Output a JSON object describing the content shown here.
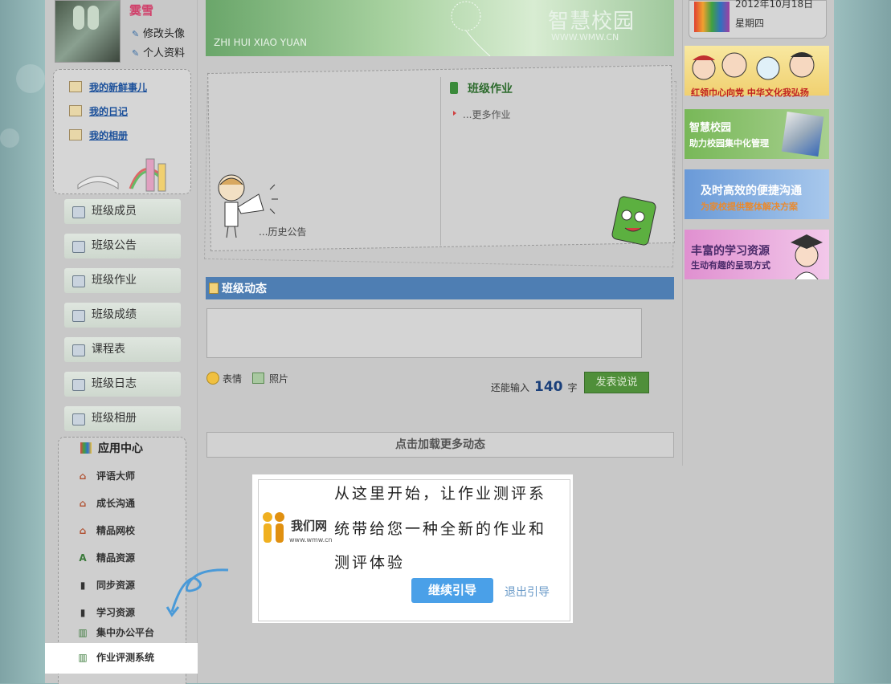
{
  "profile": {
    "name": "霙雪",
    "links": [
      {
        "label": "修改头像",
        "icon": "pencil-icon"
      },
      {
        "label": "个人资料",
        "icon": "pencil-icon"
      }
    ]
  },
  "my_links": [
    {
      "label": "我的新鲜事儿"
    },
    {
      "label": "我的日记"
    },
    {
      "label": "我的相册"
    }
  ],
  "class_menu": [
    {
      "label": "班级成员",
      "icon": "members-icon"
    },
    {
      "label": "班级公告",
      "icon": "announcement-icon"
    },
    {
      "label": "班级作业",
      "icon": "homework-icon"
    },
    {
      "label": "班级成绩",
      "icon": "grades-icon"
    },
    {
      "label": "课程表",
      "icon": "calendar-icon"
    },
    {
      "label": "班级日志",
      "icon": "log-icon"
    },
    {
      "label": "班级相册",
      "icon": "album-icon"
    }
  ],
  "app_center": {
    "title": "应用中心",
    "items": [
      {
        "label": "评语大师",
        "icon": "house-icon"
      },
      {
        "label": "成长沟通",
        "icon": "house-icon"
      },
      {
        "label": "精品网校",
        "icon": "house-icon"
      },
      {
        "label": "精品资源",
        "icon": "letter-a-icon"
      },
      {
        "label": "同步资源",
        "icon": "phone-icon"
      },
      {
        "label": "学习资源",
        "icon": "phone-icon"
      },
      {
        "label": "集中办公平台",
        "icon": "book-icon"
      },
      {
        "label": "作业评测系统",
        "icon": "book-icon"
      }
    ]
  },
  "banner": {
    "title": "智慧校园",
    "subtitle": "WWW.WMW.CN",
    "pinyin": "ZHI HUI XIAO YUAN"
  },
  "homework": {
    "title": "班级作业",
    "more": "...更多作业"
  },
  "notice": {
    "history": "...历史公告"
  },
  "dynamics": {
    "title": "班级动态",
    "tools": [
      {
        "label": "表情",
        "icon": "smiley-icon"
      },
      {
        "label": "照片",
        "icon": "photo-icon"
      }
    ],
    "remaining_prefix": "还能输入",
    "remaining_count": "140",
    "remaining_suffix": "字",
    "publish": "发表说说",
    "load_more": "点击加载更多动态"
  },
  "sidebar_right": {
    "date": "2012年10月18日",
    "weekday": "星期四",
    "ads": [
      {
        "line1": "红领巾心向党  中华文化我弘扬",
        "line2": ""
      },
      {
        "line1": "智慧校园",
        "line2": "助力校园集中化管理"
      },
      {
        "line1": "及时高效的便捷沟通",
        "line2": "为家校提供整体解决方案"
      },
      {
        "line1": "丰富的学习资源",
        "line2": "生动有趣的呈现方式"
      }
    ]
  },
  "guide": {
    "logo": "我们网",
    "logo_sub": "www.wmw.cn",
    "lines": [
      "从这里开始，让作业测评系",
      "统带给您一种全新的作业和",
      "测评体验"
    ],
    "continue": "继续引导",
    "exit": "退出引导"
  }
}
